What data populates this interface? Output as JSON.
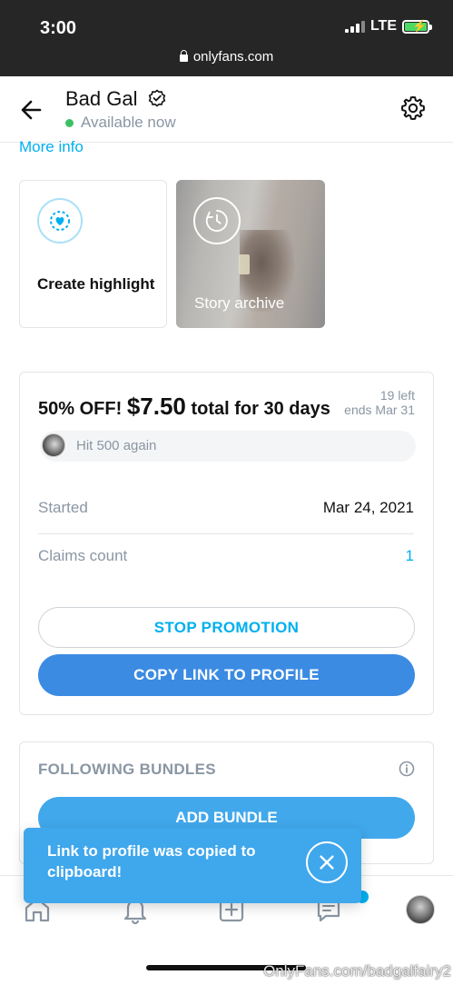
{
  "status_bar": {
    "time": "3:00",
    "network": "LTE",
    "url": "onlyfans.com"
  },
  "header": {
    "name": "Bad Gal",
    "status": "Available now"
  },
  "more_info": "More info",
  "highlights": {
    "create_label": "Create highlight",
    "archive_label": "Story archive"
  },
  "promotion": {
    "title_prefix": "50% OFF!",
    "price": "$7.50",
    "title_suffix": "total for 30 days",
    "left": "19 left",
    "ends": "ends Mar 31",
    "message": "Hit 500 again",
    "started_label": "Started",
    "started_value": "Mar 24, 2021",
    "claims_label": "Claims count",
    "claims_value": "1",
    "stop_button": "STOP PROMOTION",
    "copy_button": "COPY LINK TO PROFILE"
  },
  "bundles": {
    "title": "FOLLOWING BUNDLES",
    "add_button": "ADD BUNDLE"
  },
  "toast": {
    "message": "Link to profile was copied to clipboard!"
  },
  "watermark": "OnlyFans.com/badgalfairy2",
  "colors": {
    "accent": "#00aff0",
    "primary_button": "#3b8be3",
    "online": "#3cc063",
    "muted": "#8a96a3"
  },
  "icons": {
    "back": "arrow-left-icon",
    "verified": "verified-icon",
    "settings": "gear-icon",
    "highlight": "heart-circle-icon",
    "archive": "clock-history-icon",
    "info": "info-icon",
    "close": "close-icon",
    "nav": [
      "home-icon",
      "bell-icon",
      "plus-square-icon",
      "messages-icon",
      "avatar"
    ]
  }
}
